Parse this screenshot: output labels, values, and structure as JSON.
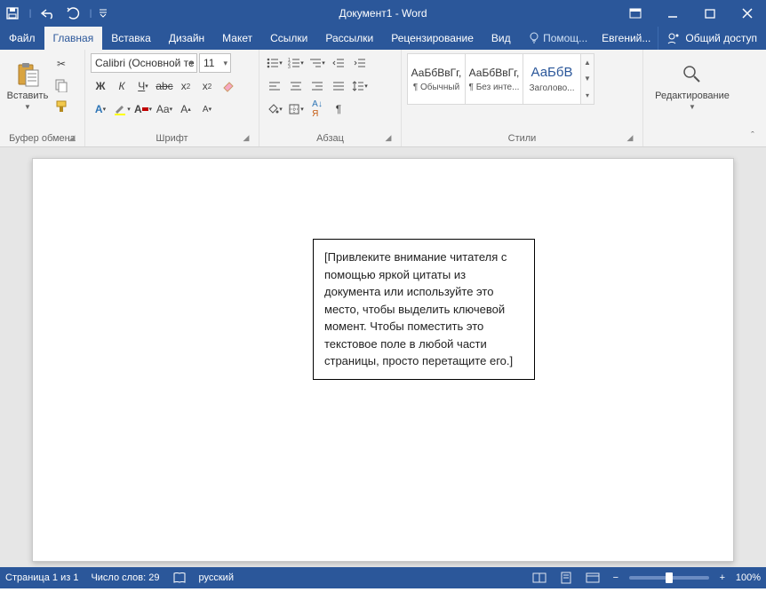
{
  "titlebar": {
    "title": "Документ1 - Word"
  },
  "tabs": {
    "file": "Файл",
    "home": "Главная",
    "insert": "Вставка",
    "design": "Дизайн",
    "layout": "Макет",
    "references": "Ссылки",
    "mailings": "Рассылки",
    "review": "Рецензирование",
    "view": "Вид",
    "tellme": "Помощ...",
    "account": "Евгений...",
    "share": "Общий доступ"
  },
  "ribbon": {
    "clipboard": {
      "label": "Буфер обмена",
      "paste": "Вставить"
    },
    "font": {
      "label": "Шрифт",
      "name": "Calibri (Основной те",
      "size": "11"
    },
    "paragraph": {
      "label": "Абзац"
    },
    "styles": {
      "label": "Стили",
      "preview": "АаБбВвГг,",
      "preview_big": "АаБбВ",
      "items": [
        "¶ Обычный",
        "¶ Без инте...",
        "Заголово..."
      ]
    },
    "editing": {
      "label": "Редактирование"
    }
  },
  "document": {
    "textbox": "[Привлеките внимание читателя с помощью яркой цитаты из документа или используйте это место, чтобы выделить ключевой момент. Чтобы поместить это текстовое поле в любой части страницы, просто перетащите его.]"
  },
  "statusbar": {
    "page": "Страница 1 из 1",
    "words": "Число слов: 29",
    "language": "русский",
    "zoom": "100%"
  }
}
